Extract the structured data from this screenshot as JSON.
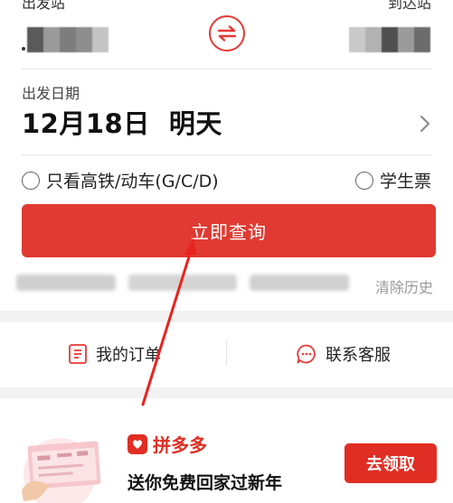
{
  "stations": {
    "from_label": "出发站",
    "to_label": "到达站"
  },
  "date": {
    "label": "出发日期",
    "value": "12月18日  明天"
  },
  "options": {
    "high_speed": "只看高铁/动车(G/C/D)",
    "student": "学生票"
  },
  "search": {
    "label": "立即查询"
  },
  "history": {
    "clear_label": "清除历史"
  },
  "links": {
    "orders": "我的订单",
    "service": "联系客服"
  },
  "promo": {
    "brand": "拼多多",
    "text": "送你免费回家过新年",
    "claim": "去领取"
  },
  "colors": {
    "accent": "#e03a33",
    "brand": "#e02e24"
  },
  "icons": {
    "swap": "swap-icon",
    "chevron": "chevron-right-icon",
    "orders": "document-icon",
    "service": "chat-icon"
  }
}
